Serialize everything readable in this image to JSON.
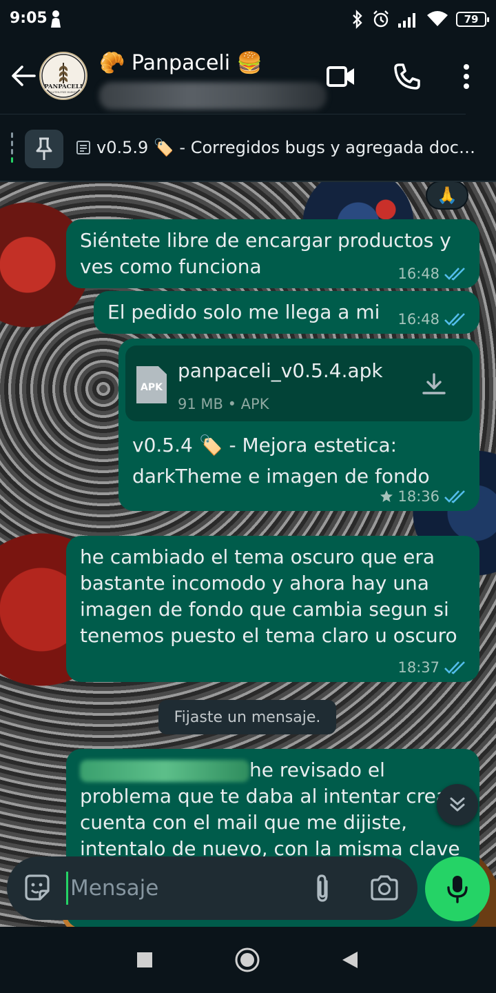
{
  "status_bar": {
    "time": "9:05",
    "battery": "79",
    "icons": [
      "person-icon",
      "bluetooth-icon",
      "alarm-icon",
      "signal-icon",
      "wifi-icon",
      "battery-icon"
    ]
  },
  "header": {
    "title": "🥐 Panpaceli 🍔",
    "avatar_text": "PANPACELI",
    "avatar_subtext": "GLUTEN-FREE MARKET"
  },
  "pinned": {
    "text": "v0.5.9 🏷️ - Corregidos bugs y agregada doc…"
  },
  "messages": [
    {
      "text": "Siéntete libre de encargar productos y ves como funciona",
      "time": "16:48"
    },
    {
      "text": "El pedido solo me llega a  mi",
      "time": "16:48"
    },
    {
      "file_name": "panpaceli_v0.5.4.apk",
      "file_type_badge": "APK",
      "file_meta": "91 MB • APK",
      "caption": "v0.5.4 🏷️ - Mejora estetica: darkTheme e imagen de fondo",
      "time": "18:36",
      "starred": true
    },
    {
      "text": "he cambiado el tema oscuro que era bastante incomodo y ahora hay una imagen de fondo que cambia segun si tenemos puesto el tema claro u oscuro",
      "time": "18:37"
    },
    {
      "text": "he revisado el problema que te daba al intentar crear cuenta con el mail que me dijiste, intentalo de nuevo, con la misma clave"
    }
  ],
  "reaction": "🙏",
  "system_message": "Fijaste un mensaje.",
  "composer": {
    "placeholder": "Mensaje"
  },
  "colors": {
    "background": "#0b141a",
    "bubble_outgoing": "#005c4b",
    "accent_green": "#25d366",
    "read_ticks": "#53bdeb"
  }
}
